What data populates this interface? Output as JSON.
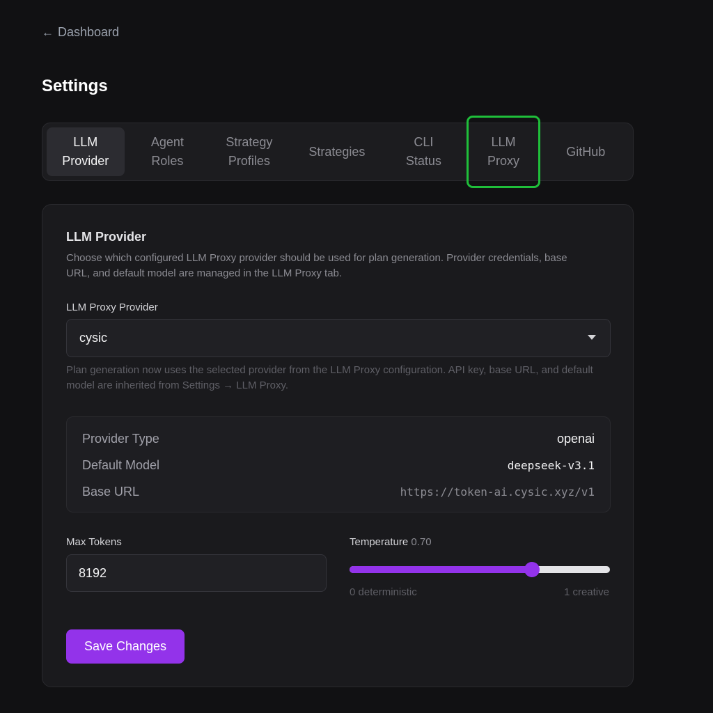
{
  "nav": {
    "back_arrow": "←",
    "back_label": "Dashboard"
  },
  "page": {
    "title": "Settings"
  },
  "tabs": [
    {
      "label": "LLM\nProvider",
      "active": true
    },
    {
      "label": "Agent\nRoles"
    },
    {
      "label": "Strategy\nProfiles"
    },
    {
      "label": "Strategies"
    },
    {
      "label": "CLI\nStatus"
    },
    {
      "label": "LLM\nProxy",
      "highlighted": true
    },
    {
      "label": "GitHub"
    }
  ],
  "section": {
    "title": "LLM Provider",
    "description": "Choose which configured LLM Proxy provider should be used for plan generation. Provider credentials, base URL, and default model are managed in the LLM Proxy tab."
  },
  "provider_select": {
    "label": "LLM Proxy Provider",
    "value": "cysic",
    "hint": "Plan generation now uses the selected provider from the LLM Proxy configuration. API key, base URL, and default model are inherited from Settings → LLM Proxy."
  },
  "info": {
    "provider_type_label": "Provider Type",
    "provider_type_value": "openai",
    "default_model_label": "Default Model",
    "default_model_value": "deepseek-v3.1",
    "base_url_label": "Base URL",
    "base_url_value": "https://token-ai.cysic.xyz/v1"
  },
  "max_tokens": {
    "label": "Max Tokens",
    "value": "8192"
  },
  "temperature": {
    "label": "Temperature",
    "value_text": "0.70",
    "value": 0.7,
    "min_label": "0 deterministic",
    "max_label": "1 creative"
  },
  "actions": {
    "save_label": "Save Changes"
  },
  "colors": {
    "accent": "#9333ea",
    "highlight_outline": "#1fbf3a",
    "background": "#111113"
  }
}
